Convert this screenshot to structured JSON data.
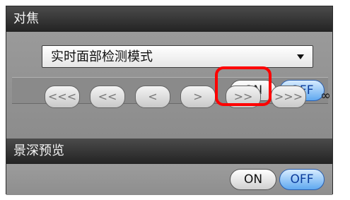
{
  "focus": {
    "header": "对焦",
    "mode_select": {
      "value": "实时面部检测模式"
    },
    "on_label": "ON",
    "off_label": "OFF",
    "selected": "OFF",
    "steps": [
      "<<<",
      "<<",
      "<",
      ">",
      ">>",
      ">>>"
    ],
    "infinity": "∞"
  },
  "dof_preview": {
    "header": "景深预览",
    "on_label": "ON",
    "off_label": "OFF",
    "selected": "OFF"
  },
  "colors": {
    "highlight": "#ff0000",
    "selected_blue": "#5fa8f0"
  }
}
